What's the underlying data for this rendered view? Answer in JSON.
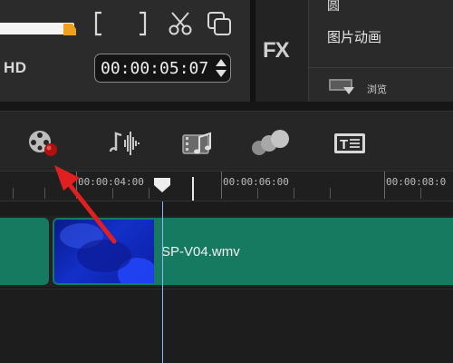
{
  "preview": {
    "quality_label": "HD",
    "timecode": "00:00:05:07"
  },
  "effects": {
    "fx_label": "FX"
  },
  "library": {
    "items": [
      "圆",
      "图片动画"
    ],
    "browse_label": "浏览"
  },
  "toolbar": {
    "tools": [
      "film-reel-icon",
      "audio-wave-icon",
      "music-note-icon",
      "overlay-circles-icon",
      "title-icon"
    ]
  },
  "ruler": {
    "ticks": [
      "00:00:04:00",
      "00:00:06:00",
      "00:00:08:0"
    ]
  },
  "timeline": {
    "clip_name": "SP-V04.wmv"
  },
  "colors": {
    "clip": "#167a60",
    "accent_arrow": "#e02020",
    "scrub_orange": "#f0a020"
  }
}
